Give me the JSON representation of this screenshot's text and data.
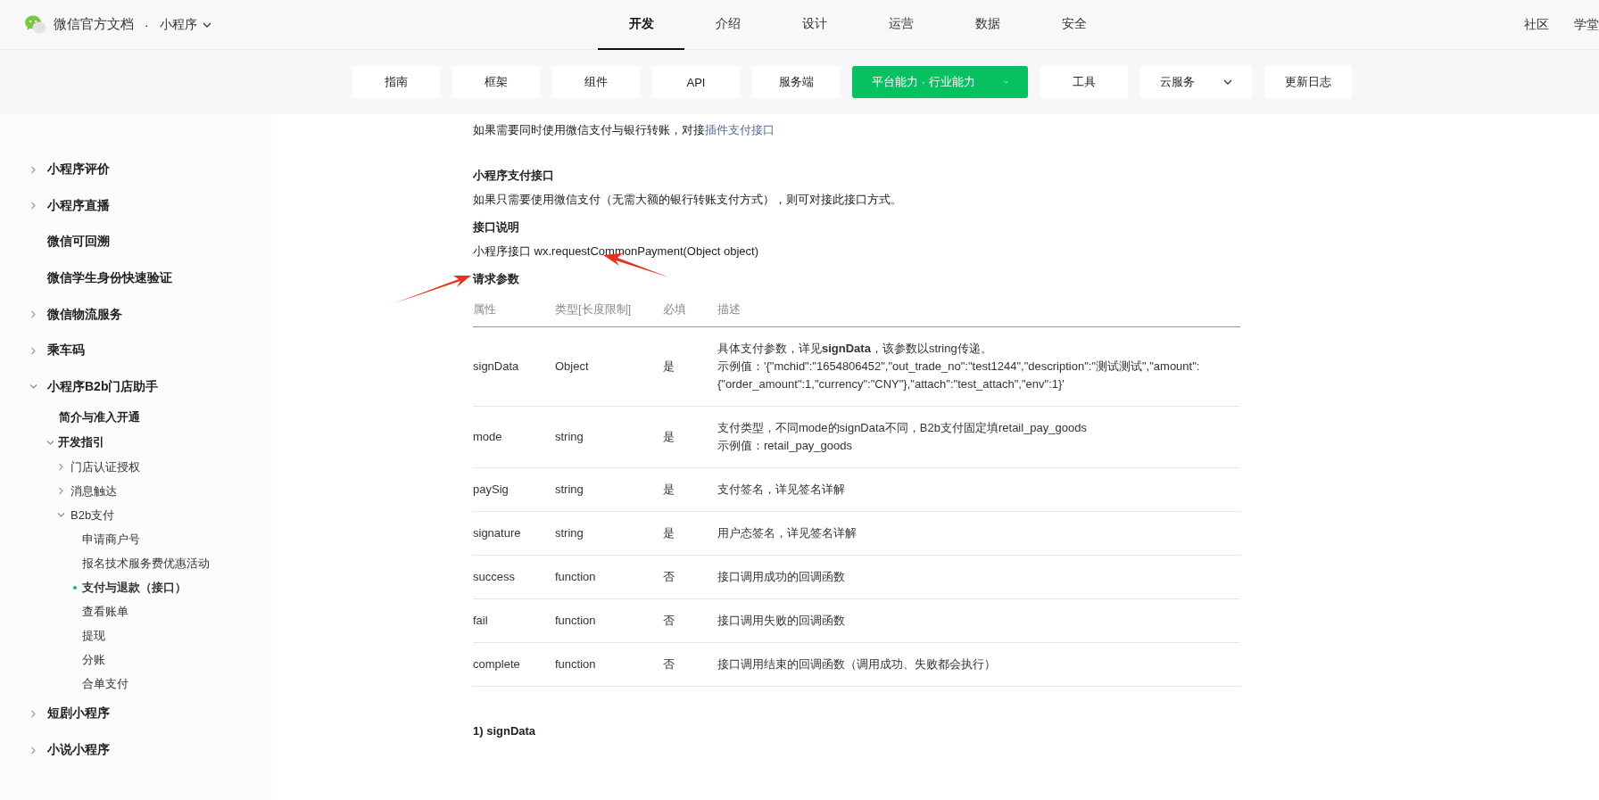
{
  "header": {
    "site_title": "微信官方文档",
    "separator": "·",
    "product": "小程序",
    "nav": [
      {
        "label": "开发",
        "selected": true
      },
      {
        "label": "介绍",
        "selected": false
      },
      {
        "label": "设计",
        "selected": false
      },
      {
        "label": "运营",
        "selected": false
      },
      {
        "label": "数据",
        "selected": false
      },
      {
        "label": "安全",
        "selected": false
      }
    ],
    "links": [
      "社区",
      "学堂"
    ]
  },
  "subnav": [
    {
      "label": "指南",
      "selected": false,
      "dropdown": false
    },
    {
      "label": "框架",
      "selected": false,
      "dropdown": false
    },
    {
      "label": "组件",
      "selected": false,
      "dropdown": false
    },
    {
      "label": "API",
      "selected": false,
      "dropdown": false
    },
    {
      "label": "服务端",
      "selected": false,
      "dropdown": false
    },
    {
      "label": "平台能力 · 行业能力",
      "selected": true,
      "dropdown": true
    },
    {
      "label": "工具",
      "selected": false,
      "dropdown": false
    },
    {
      "label": "云服务",
      "selected": false,
      "dropdown": true
    },
    {
      "label": "更新日志",
      "selected": false,
      "dropdown": false
    }
  ],
  "sidebar": [
    {
      "label": "小程序评价",
      "expanded": false,
      "selected": false
    },
    {
      "label": "小程序直播",
      "expanded": false,
      "selected": false
    },
    {
      "label": "微信可回溯",
      "selected": false
    },
    {
      "label": "微信学生身份快速验证",
      "selected": false
    },
    {
      "label": "微信物流服务",
      "expanded": false,
      "selected": false
    },
    {
      "label": "乘车码",
      "expanded": false,
      "selected": false
    },
    {
      "label": "小程序B2b门店助手",
      "expanded": true,
      "selected": false,
      "children": [
        {
          "label": "简介与准入开通",
          "selected": false
        },
        {
          "label": "开发指引",
          "expanded": true,
          "selected": false,
          "children": [
            {
              "label": "门店认证授权",
              "expanded": false,
              "selected": false
            },
            {
              "label": "消息触达",
              "expanded": false,
              "selected": false
            },
            {
              "label": "B2b支付",
              "expanded": true,
              "selected": false,
              "children": [
                {
                  "label": "申请商户号",
                  "selected": false
                },
                {
                  "label": "报名技术服务费优惠活动",
                  "selected": false
                },
                {
                  "label": "支付与退款（接口）",
                  "selected": true
                },
                {
                  "label": "查看账单",
                  "selected": false
                },
                {
                  "label": "提现",
                  "selected": false
                },
                {
                  "label": "分账",
                  "selected": false
                },
                {
                  "label": "合单支付",
                  "selected": false
                }
              ]
            }
          ]
        }
      ]
    },
    {
      "label": "短剧小程序",
      "expanded": false,
      "selected": false
    },
    {
      "label": "小说小程序",
      "expanded": false,
      "selected": false
    }
  ],
  "content": {
    "intro": {
      "text": "如果需要同时使用微信支付与银行转账，对接",
      "link": "插件支付接口"
    },
    "section_title": "小程序支付接口",
    "section_text": "如果只需要使用微信支付（无需大额的银行转账支付方式），则可对接此接口方式。",
    "api_title": "接口说明",
    "api_text": "小程序接口 wx.requestCommonPayment(Object object)",
    "params_title": "请求参数",
    "table": {
      "columns": [
        "属性",
        "类型[长度限制]",
        "必填",
        "描述"
      ],
      "rows": [
        {
          "name": "signData",
          "type": "Object",
          "required": "是",
          "description": [
            "具体支付参数，详见**signData**，该参数以string传递。",
            "示例值：'{\"mchid\":\"1654806452\",\"out_trade_no\":\"test1244\",\"description\":\"测试测试\",\"amount\":{\"order_amount\":1,\"currency\":\"CNY\"},\"attach\":\"test_attach\",\"env\":1}'"
          ]
        },
        {
          "name": "mode",
          "type": "string",
          "required": "是",
          "description": [
            "支付类型，不同mode的signData不同，B2b支付固定填retail_pay_goods",
            "示例值：retail_pay_goods"
          ]
        },
        {
          "name": "paySig",
          "type": "string",
          "required": "是",
          "description": [
            "支付签名，详见签名详解"
          ]
        },
        {
          "name": "signature",
          "type": "string",
          "required": "是",
          "description": [
            "用户态签名，详见签名详解"
          ]
        },
        {
          "name": "success",
          "type": "function",
          "required": "否",
          "description": [
            "接口调用成功的回调函数"
          ]
        },
        {
          "name": "fail",
          "type": "function",
          "required": "否",
          "description": [
            "接口调用失败的回调函数"
          ]
        },
        {
          "name": "complete",
          "type": "function",
          "required": "否",
          "description": [
            "接口调用结束的回调函数（调用成功、失败都会执行）"
          ]
        }
      ]
    },
    "next_heading": "1) signData"
  }
}
